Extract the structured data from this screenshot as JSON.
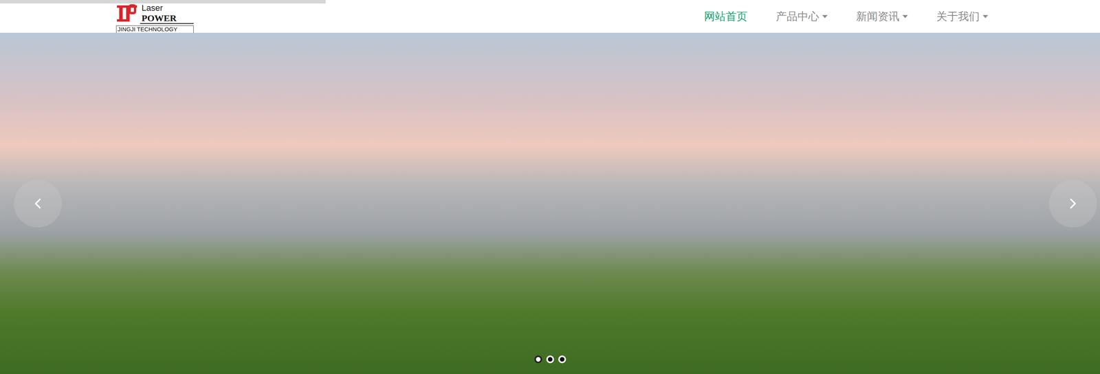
{
  "loading_bar": {
    "level": 0.296
  },
  "logo": {
    "line1": "Laser",
    "line2": "POWER",
    "line3": "JINGJI TECHNOLOGY"
  },
  "nav": [
    {
      "label": "网站首页",
      "selected": true,
      "dropdown": false
    },
    {
      "label": "产品中心",
      "selected": false,
      "dropdown": true
    },
    {
      "label": "新闻资讯",
      "selected": false,
      "dropdown": true
    },
    {
      "label": "关于我们",
      "selected": false,
      "dropdown": true
    }
  ],
  "carousel": {
    "dots": [
      {
        "selected": true
      },
      {
        "selected": false
      },
      {
        "selected": false
      }
    ]
  }
}
